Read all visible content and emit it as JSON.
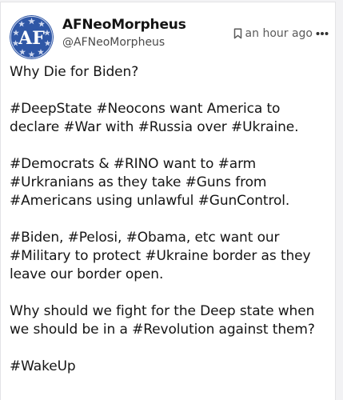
{
  "post": {
    "display_name": "AFNeoMorpheus",
    "handle": "@AFNeoMorpheus",
    "timestamp": "an hour ago",
    "avatar_text": "AF",
    "paragraphs": [
      "Why Die for Biden?",
      "#DeepState #Neocons want America to declare #War with #Russia over #Ukraine.",
      "#Democrats & #RINO want to #arm #Urkranians as they take #Guns from #Americans using unlawful #GunControl.",
      "#Biden, #Pelosi, #Obama, etc want our #Military to protect #Ukraine border as they leave our border open.",
      "Why should we fight for the Deep state when we should be in a #Revolution against them?",
      "#WakeUp"
    ]
  },
  "icons": {
    "bookmark": "bookmark-icon",
    "more": "more-options-icon",
    "avatar": "avatar-icon"
  },
  "colors": {
    "avatar_blue": "#2f57a6",
    "avatar_star": "#cfd8ee"
  }
}
